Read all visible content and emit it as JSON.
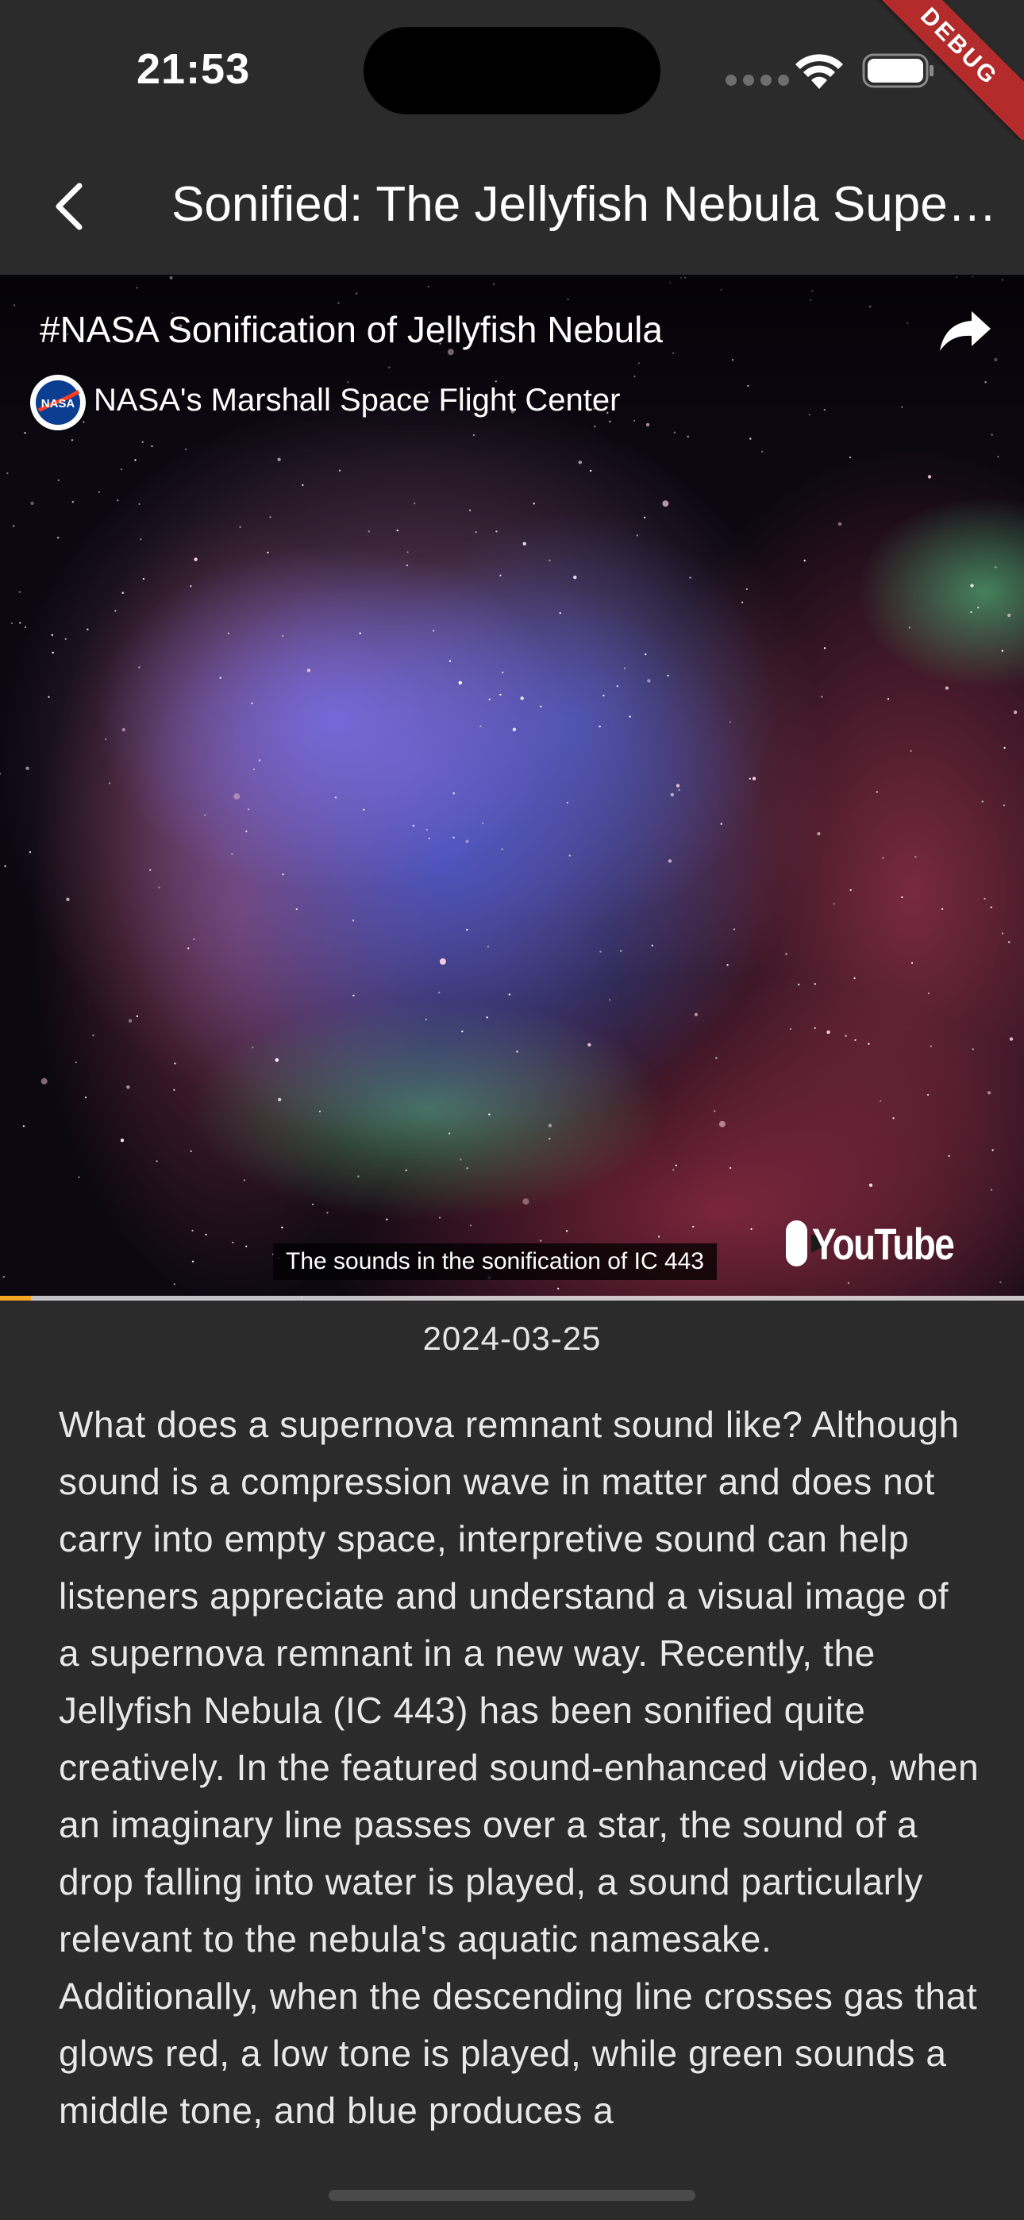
{
  "status_bar": {
    "time": "21:53",
    "debug_label": "DEBUG"
  },
  "app_bar": {
    "title": "Sonified: The Jellyfish Nebula Supernova Remnant",
    "back_icon": "chevron-left-icon"
  },
  "video": {
    "title": "#NASA Sonification of Jellyfish Nebula",
    "channel": "NASA's Marshall Space Flight Center",
    "channel_logo_text": "NASA",
    "caption": "The sounds in the sonification of IC 443",
    "logo_text": "YouTube",
    "share_icon": "share-arrow-icon",
    "progress": 0.03,
    "progress_color": "#f5a623"
  },
  "content": {
    "date": "2024-03-25",
    "description": "What does a supernova remnant sound like? Although sound is a compression wave in matter and does not carry into empty space, interpretive sound can help listeners appreciate and understand a visual image of a supernova remnant in a new way. Recently, the Jellyfish Nebula (IC 443) has been sonified quite creatively.  In the featured sound-enhanced video, when an imaginary line passes over a star, the sound of a drop falling into water is played, a sound particularly relevant to the nebula's aquatic namesake.  Additionally, when the descending line crosses gas that glows red, a low tone is played, while green sounds a middle tone, and blue produces a"
  },
  "colors": {
    "background": "#2b2b2b",
    "debug_ribbon": "#b32b2b"
  }
}
